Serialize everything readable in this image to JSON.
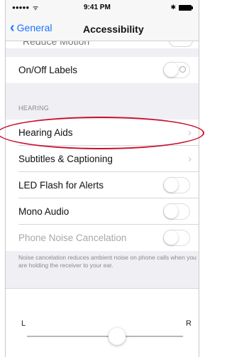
{
  "status_bar": {
    "signal": "●●●●●",
    "wifi": "ᯤ",
    "time": "9:41 PM",
    "bluetooth": "✱"
  },
  "nav": {
    "back_label": "General",
    "title": "Accessibility"
  },
  "partial_row_label": "Reduce Motion",
  "rows": {
    "on_off_labels": "On/Off Labels",
    "hearing_aids": "Hearing Aids",
    "subtitles": "Subtitles & Captioning",
    "led_flash": "LED Flash for Alerts",
    "mono_audio": "Mono Audio",
    "phone_noise": "Phone Noise Cancelation"
  },
  "section_header": "HEARING",
  "footnote": "Noise cancelation reduces ambient noise on phone calls when you are holding the receiver to your ear.",
  "balance": {
    "left_label": "L",
    "right_label": "R",
    "value": 0.5
  },
  "colors": {
    "accent": "#1a75ff",
    "highlight": "#c8102e"
  }
}
